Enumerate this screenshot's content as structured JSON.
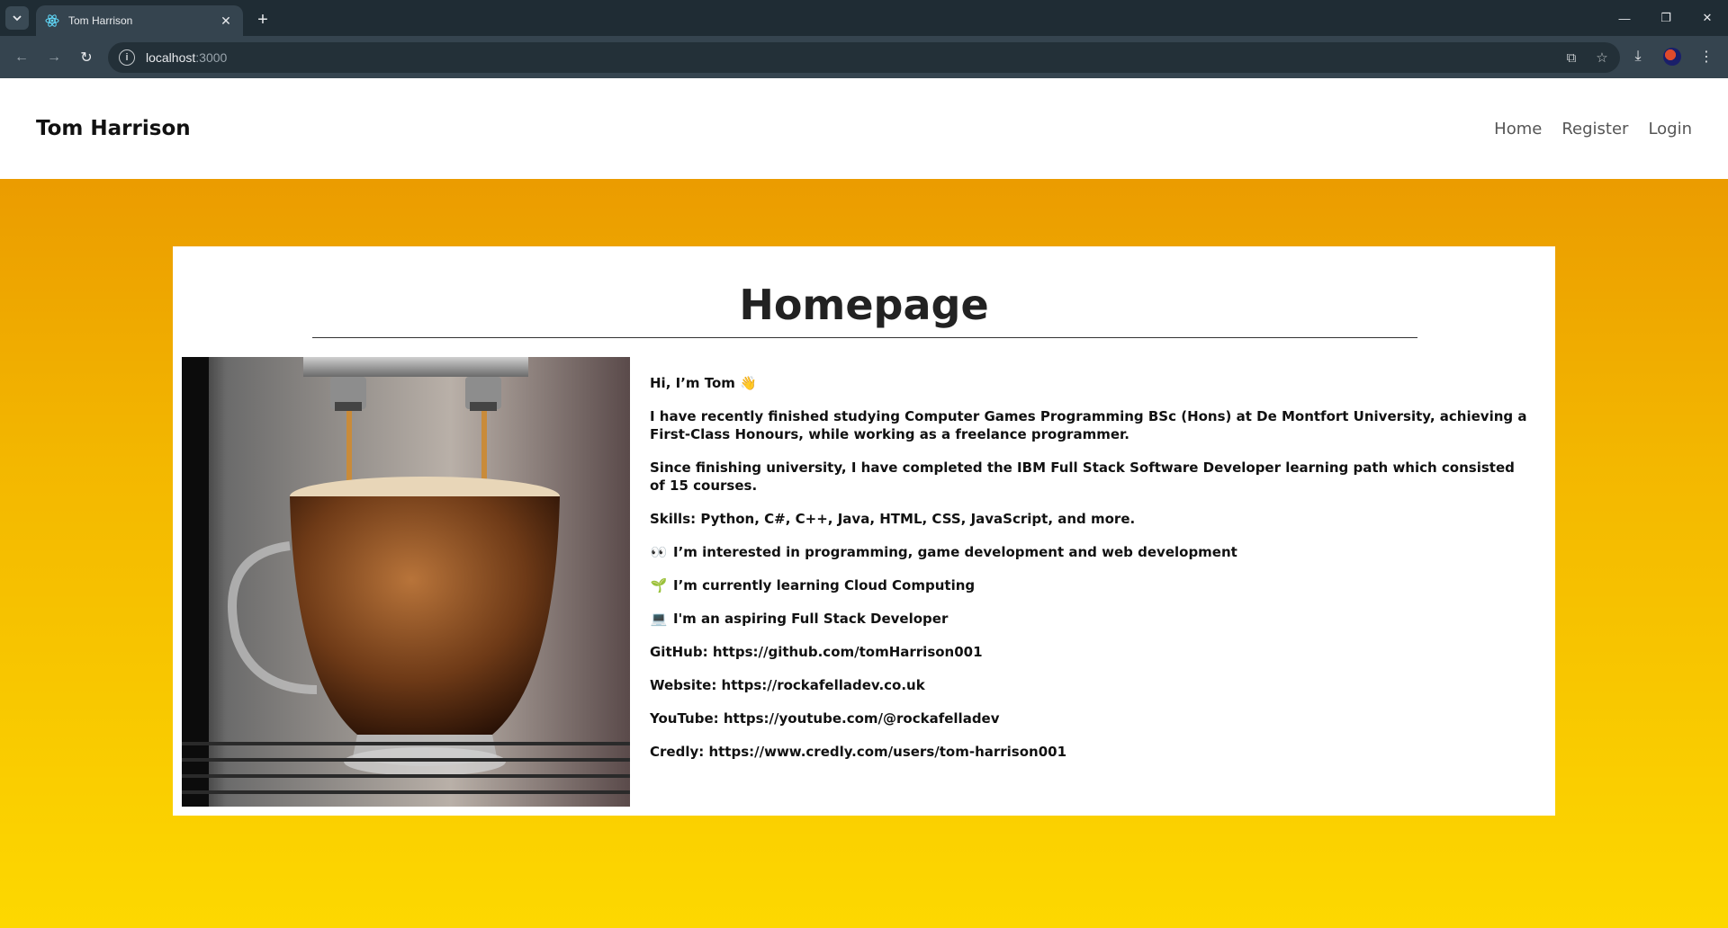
{
  "browser": {
    "tab_title": "Tom Harrison",
    "new_tab_label": "+",
    "url_host": "localhost",
    "url_port": ":3000"
  },
  "site": {
    "brand": "Tom Harrison",
    "nav": [
      {
        "label": "Home"
      },
      {
        "label": "Register"
      },
      {
        "label": "Login"
      }
    ]
  },
  "card": {
    "title": "Homepage",
    "image_alt": "Coffee cup under an espresso machine",
    "paragraphs": [
      {
        "emoji": "",
        "text": "Hi, I’m Tom 👋"
      },
      {
        "emoji": "",
        "text": "I have recently finished studying Computer Games Programming BSc (Hons) at De Montfort University, achieving a First-Class Honours, while working as a freelance programmer."
      },
      {
        "emoji": "",
        "text": "Since finishing university, I have completed the IBM Full Stack Software Developer learning path which consisted of 15 courses."
      },
      {
        "emoji": "",
        "text": "Skills: Python, C#, C++, Java, HTML, CSS, JavaScript, and more."
      },
      {
        "emoji": "👀",
        "text": "I’m interested in programming, game development and web development"
      },
      {
        "emoji": "🌱",
        "text": "I’m currently learning Cloud Computing"
      },
      {
        "emoji": "💻",
        "text": "I'm an aspiring Full Stack Developer"
      },
      {
        "emoji": "",
        "text": "GitHub: https://github.com/tomHarrison001"
      },
      {
        "emoji": "",
        "text": "Website: https://rockafelladev.co.uk"
      },
      {
        "emoji": "",
        "text": "YouTube: https://youtube.com/@rockafelladev"
      },
      {
        "emoji": "",
        "text": "Credly: https://www.credly.com/users/tom-harrison001"
      }
    ]
  },
  "colors": {
    "gradient_top": "#e89200",
    "gradient_bottom": "#fdd800",
    "chrome_bg": "#1f2c34"
  }
}
